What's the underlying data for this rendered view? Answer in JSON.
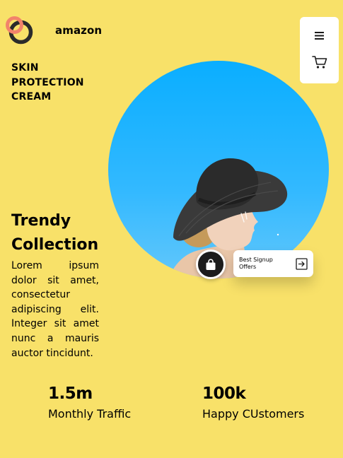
{
  "header": {
    "brand": "amazon",
    "menu_icon": "hamburger-menu-icon",
    "cart_icon": "shopping-cart-icon"
  },
  "product": {
    "title_lines": [
      "SKIN",
      "PROTECTION",
      "CREAM"
    ]
  },
  "hero": {
    "heading_lines": [
      "Trendy",
      "Collection"
    ],
    "paragraph": "Lorem ipsum dolor sit amet, consectetur adipiscing elit. Integer sit amet nunc a mauris auctor tincidunt."
  },
  "signup": {
    "text": "Best Signup Offers",
    "bag_icon": "shopping-bag-icon",
    "arrow_icon": "arrow-right-box-icon"
  },
  "stats": [
    {
      "value": "1.5m",
      "label": "Monthly Traffic"
    },
    {
      "value": "100k",
      "label": "Happy CUstomers"
    }
  ],
  "colors": {
    "background": "#f8e169",
    "circle": "#0aaeff",
    "logo_ring_dark": "#2b2b2b",
    "logo_ring_accent": "#f2836b"
  }
}
